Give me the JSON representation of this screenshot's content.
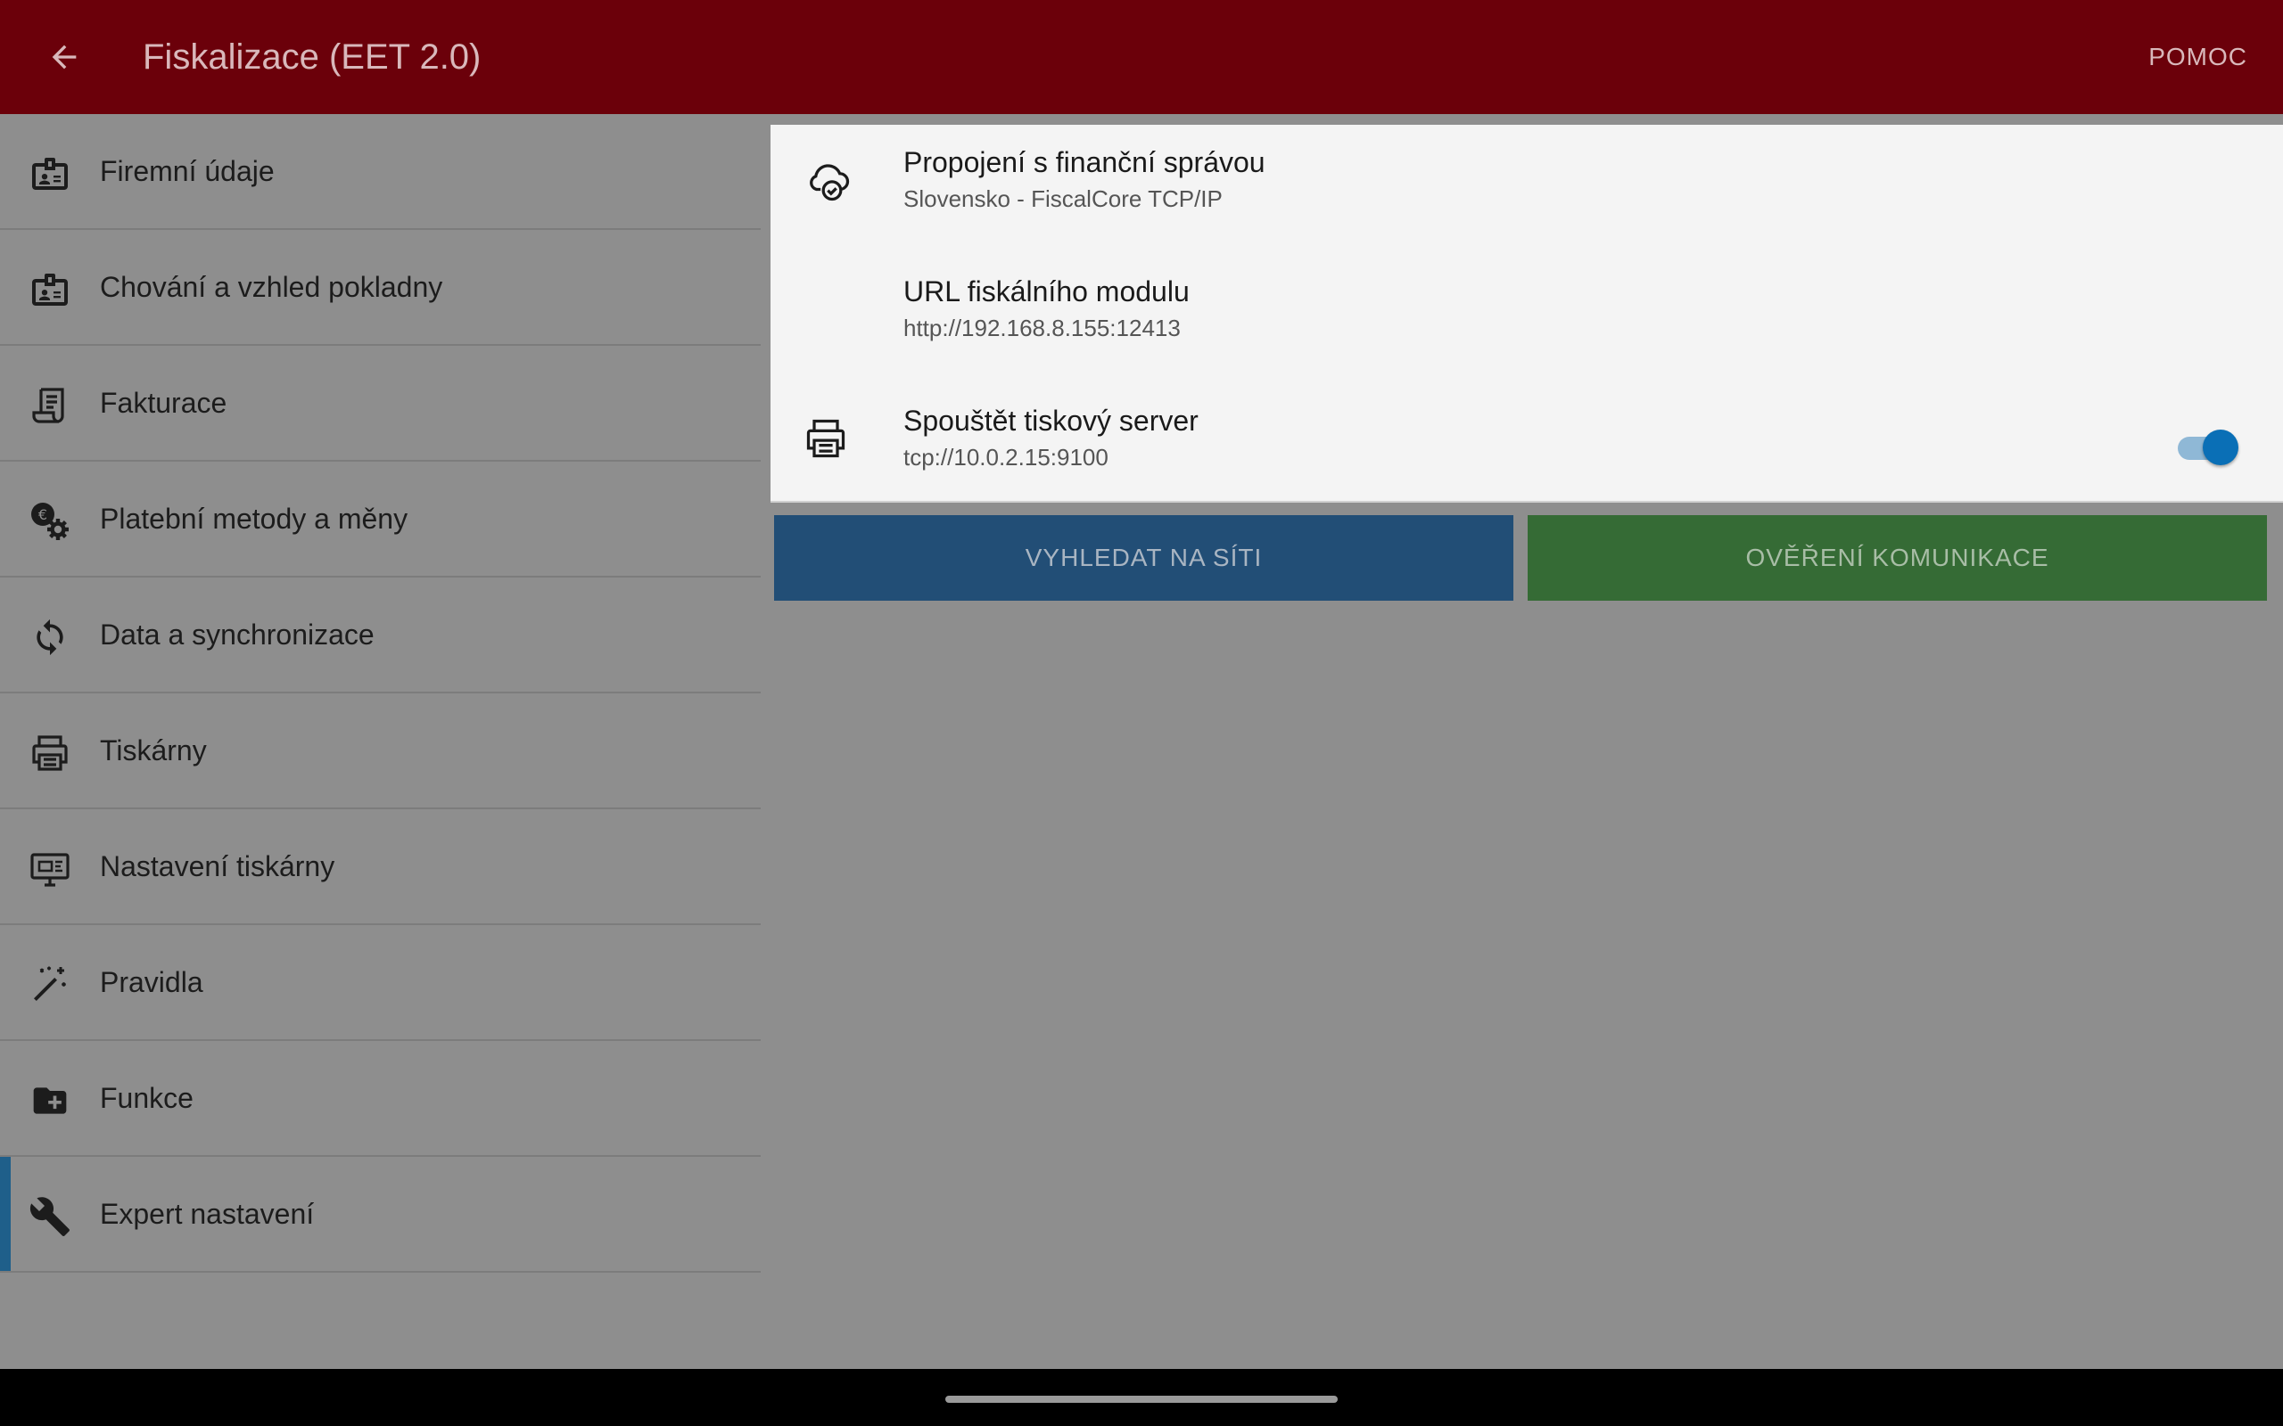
{
  "appbar": {
    "title": "Fiskalizace (EET 2.0)",
    "help_label": "POMOC",
    "bg_color": "#6b000a"
  },
  "sidebar": {
    "items": [
      {
        "label": "Firemní údaje",
        "icon": "company-badge-icon"
      },
      {
        "label": "Chování a vzhled pokladny",
        "icon": "register-badge-icon"
      },
      {
        "label": "Fakturace",
        "icon": "invoice-scroll-icon"
      },
      {
        "label": "Platební metody a měny",
        "icon": "currency-gear-icon"
      },
      {
        "label": "Data a synchronizace",
        "icon": "sync-icon"
      },
      {
        "label": "Tiskárny",
        "icon": "printer-icon"
      },
      {
        "label": "Nastavení tiskárny",
        "icon": "printer-settings-icon"
      },
      {
        "label": "Pravidla",
        "icon": "magic-wand-icon"
      },
      {
        "label": "Funkce",
        "icon": "folder-plus-icon"
      },
      {
        "label": "Expert nastavení",
        "icon": "wrench-icon"
      }
    ],
    "active_index": 9
  },
  "prefs": {
    "connection": {
      "title": "Propojení s finanční správou",
      "summary": "Slovensko - FiscalCore TCP/IP",
      "icon": "cloud-check-icon"
    },
    "module_url": {
      "title": "URL fiskálního modulu",
      "summary": "http://192.168.8.155:12413"
    },
    "print_server": {
      "title": "Spouštět tiskový server",
      "summary": "tcp://10.0.2.15:9100",
      "icon": "printer-icon",
      "enabled": true
    }
  },
  "buttons": {
    "search_label": "VYHLEDAT NA SÍTI",
    "verify_label": "OVĚŘENÍ KOMUNIKACE",
    "search_color": "#224e76",
    "verify_color": "#356b35"
  }
}
